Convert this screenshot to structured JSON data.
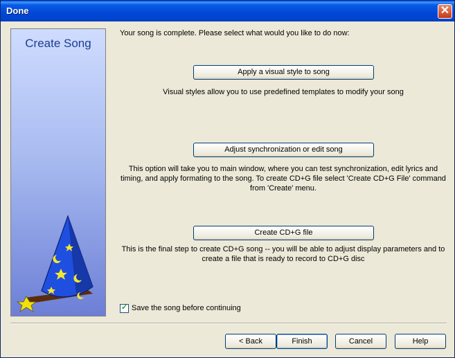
{
  "window": {
    "title": "Done",
    "close_symbol": "✕"
  },
  "side_panel": {
    "title": "Create Song"
  },
  "intro": "Your song is complete. Please select what would you like to do now:",
  "actions": [
    {
      "label": "Apply a visual style to song",
      "description": "Visual styles allow you to use predefined templates to modify your song"
    },
    {
      "label": "Adjust synchronization or edit song",
      "description": "This option will take you to main window, where you can test synchronization, edit lyrics and timing, and apply formating to the song. To create CD+G file select 'Create CD+G File' command from 'Create' menu."
    },
    {
      "label": "Create CD+G file",
      "description": "This is the final step to create CD+G song -- you will be able to adjust display parameters and to create a file that is ready to record to CD+G disc"
    }
  ],
  "save_checkbox": {
    "label": "Save the song before continuing",
    "checked": true
  },
  "footer": {
    "back": "< Back",
    "finish": "Finish",
    "cancel": "Cancel",
    "help": "Help"
  }
}
